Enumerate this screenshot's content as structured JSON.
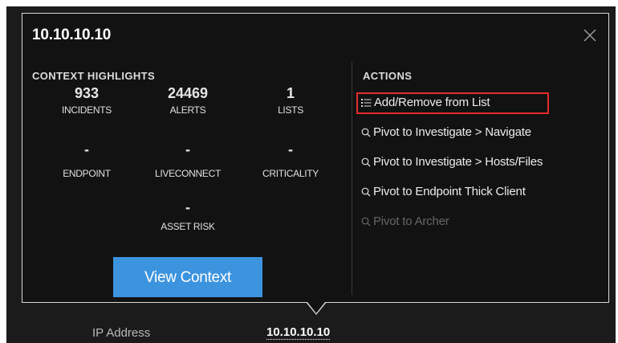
{
  "popup": {
    "title": "10.10.10.10",
    "close_icon": "close-x-icon"
  },
  "context": {
    "heading": "CONTEXT HIGHLIGHTS",
    "stats": [
      {
        "value": "933",
        "label": "INCIDENTS"
      },
      {
        "value": "24469",
        "label": "ALERTS"
      },
      {
        "value": "1",
        "label": "LISTS"
      },
      {
        "value": "-",
        "label": "ENDPOINT"
      },
      {
        "value": "-",
        "label": "LIVECONNECT"
      },
      {
        "value": "-",
        "label": "CRITICALITY"
      },
      {
        "value": "-",
        "label": "ASSET RISK"
      }
    ],
    "view_button_label": "View Context"
  },
  "actions": {
    "heading": "ACTIONS",
    "items": [
      {
        "label": "Add/Remove from List",
        "icon": "list-icon",
        "enabled": true,
        "highlighted": true
      },
      {
        "label": "Pivot to Investigate > Navigate",
        "icon": "search-icon",
        "enabled": true
      },
      {
        "label": "Pivot to Investigate > Hosts/Files",
        "icon": "search-icon",
        "enabled": true
      },
      {
        "label": "Pivot to Endpoint Thick Client",
        "icon": "search-icon",
        "enabled": true
      },
      {
        "label": "Pivot to Archer",
        "icon": "search-icon",
        "enabled": false
      }
    ]
  },
  "footer": {
    "label": "IP Address",
    "value": "10.10.10.10"
  },
  "colors": {
    "button_blue": "#3d94de",
    "highlight_red": "#e52b2b",
    "panel_bg": "#121212"
  }
}
